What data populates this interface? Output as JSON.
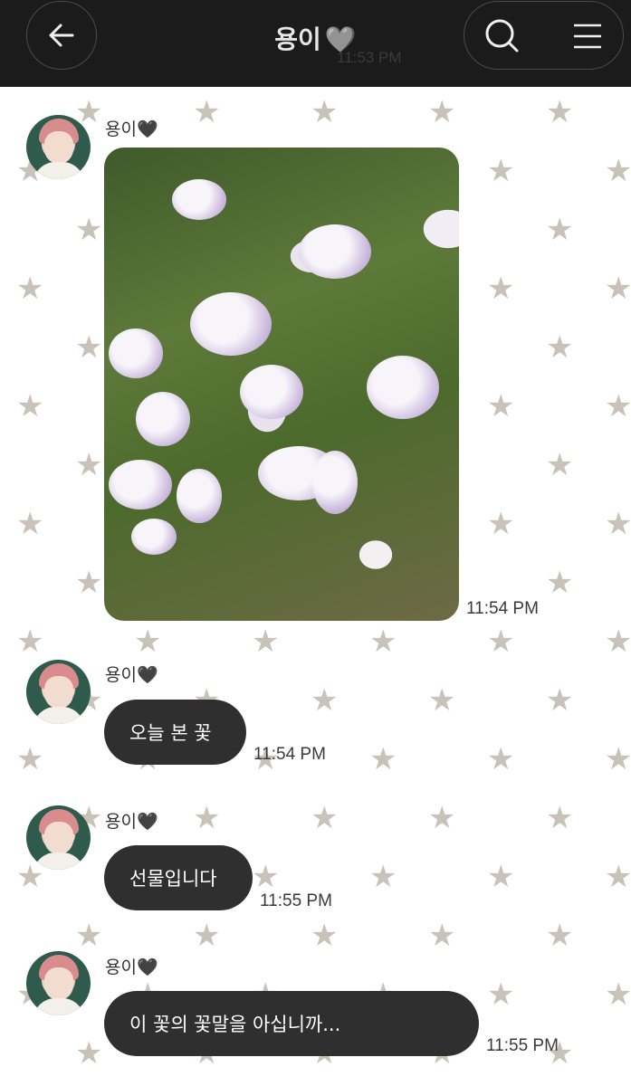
{
  "header": {
    "title": "용이",
    "title_heart": "🩶",
    "ghost_time": "11:53 PM",
    "back_icon": "arrow-left-icon",
    "search_icon": "search-icon",
    "menu_icon": "menu-icon"
  },
  "messages": [
    {
      "sender": "용이",
      "sender_heart": "🖤",
      "type": "image",
      "image_alt": "flowers photo",
      "time": "11:54 PM"
    },
    {
      "sender": "용이",
      "sender_heart": "🖤",
      "type": "text",
      "text": "오늘 본 꽃",
      "time": "11:54 PM"
    },
    {
      "sender": "용이",
      "sender_heart": "🖤",
      "type": "text",
      "text": "선물입니다",
      "time": "11:55 PM"
    },
    {
      "sender": "용이",
      "sender_heart": "🖤",
      "type": "text",
      "text": "이 꽃의 꽃말을 아십니까...",
      "time": "11:55 PM"
    }
  ],
  "colors": {
    "header_bg": "#1b1b1b",
    "bubble_bg": "#2f2f2f",
    "star": "#c9c2b8"
  }
}
